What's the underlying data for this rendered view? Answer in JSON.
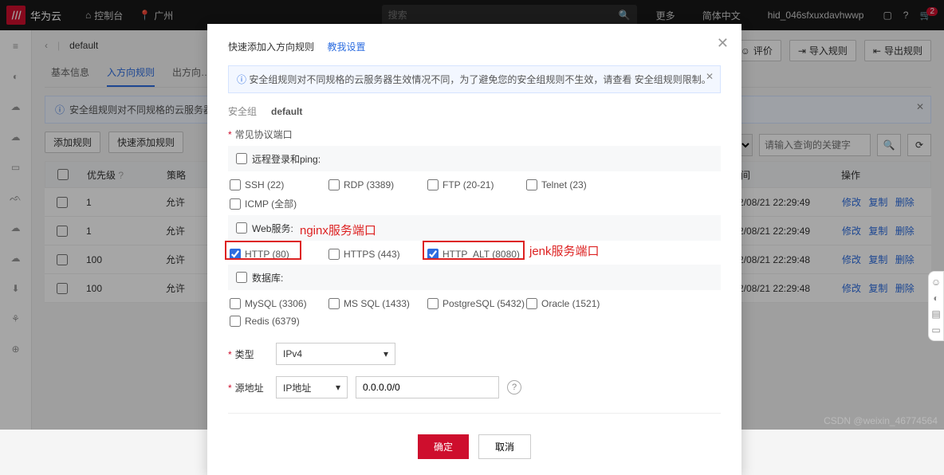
{
  "top": {
    "brand": "华为云",
    "console": "控制台",
    "region": "广州",
    "search_ph": "搜索",
    "more": "更多",
    "lang": "简体中文",
    "user": "hid_046sfxuxdavhwwp",
    "cart_badge": "2"
  },
  "crumbs": {
    "back": "‹",
    "name": "default"
  },
  "actions": {
    "eval": "评价",
    "import": "导入规则",
    "export": "导出规则"
  },
  "tabs": [
    "基本信息",
    "入方向规则",
    "出方向…"
  ],
  "active_tab": 1,
  "banner": {
    "text": "安全组规则对不同规格的云服务器…"
  },
  "btns": {
    "add": "添加规则",
    "quick": "快速添加规则"
  },
  "filter": {
    "ph": "请输入查询的关键字"
  },
  "cols": {
    "pri": "优先级",
    "pol": "策略",
    "time": "改时间",
    "ops": "操作"
  },
  "rows": [
    {
      "pri": "1",
      "pol": "允许",
      "time": "2022/08/21 22:29:49"
    },
    {
      "pri": "1",
      "pol": "允许",
      "time": "2022/08/21 22:29:49"
    },
    {
      "pri": "100",
      "pol": "允许",
      "time": "2022/08/21 22:29:48"
    },
    {
      "pri": "100",
      "pol": "允许",
      "time": "2022/08/21 22:29:48"
    }
  ],
  "ops": {
    "edit": "修改",
    "copy": "复制",
    "del": "删除"
  },
  "modal": {
    "title": "快速添加入方向规则",
    "teach": "教我设置",
    "info_text": "安全组规则对不同规格的云服务器生效情况不同，为了避免您的安全组规则不生效，请查看 ",
    "info_link": "安全组规则限制。",
    "sg_lbl": "安全组",
    "sg_val": "default",
    "ports_lbl": "常见协议端口",
    "g1": "远程登录和ping:",
    "g1_opts": [
      "SSH (22)",
      "RDP (3389)",
      "FTP (20-21)",
      "Telnet (23)",
      "ICMP (全部)"
    ],
    "g2": "Web服务:",
    "g2_opts": [
      "HTTP (80)",
      "HTTPS (443)",
      "HTTP_ALT (8080)"
    ],
    "g3": "数据库:",
    "g3_opts": [
      "MySQL (3306)",
      "MS SQL (1433)",
      "PostgreSQL (5432)",
      "Oracle (1521)",
      "Redis (6379)"
    ],
    "type_lbl": "类型",
    "type_val": "IPv4",
    "src_lbl": "源地址",
    "src_sel": "IP地址",
    "src_val": "0.0.0.0/0",
    "ok": "确定",
    "cancel": "取消"
  },
  "anno": {
    "nginx": "nginx服务端口",
    "jenk": "jenk服务端口"
  },
  "watermark": "CSDN @weixin_46774564"
}
